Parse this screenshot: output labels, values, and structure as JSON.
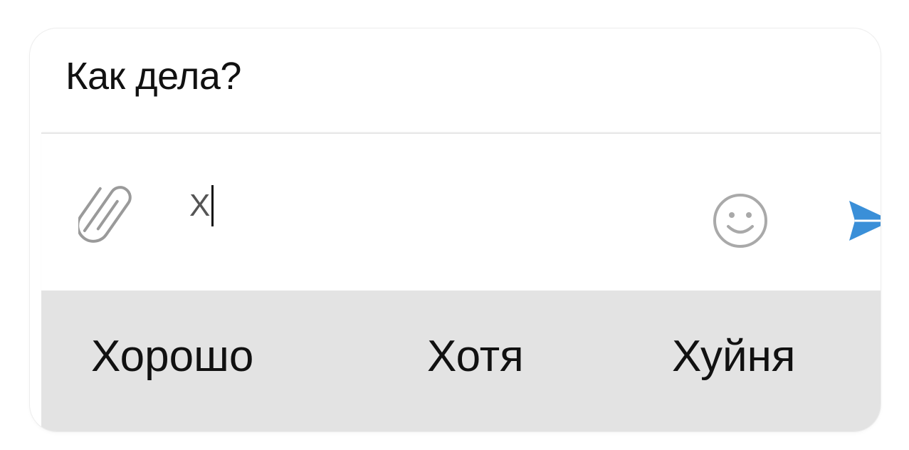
{
  "chat": {
    "message": "Как дела?"
  },
  "composer": {
    "input_value": "Х",
    "attach_icon": "paperclip-icon",
    "emoji_icon": "smiley-icon",
    "send_icon": "send-arrow-icon",
    "send_color": "#3a8fd8"
  },
  "keyboard": {
    "suggestions": [
      "Хорошо",
      "Хотя",
      "Хуйня"
    ],
    "background": "#e3e3e3"
  }
}
